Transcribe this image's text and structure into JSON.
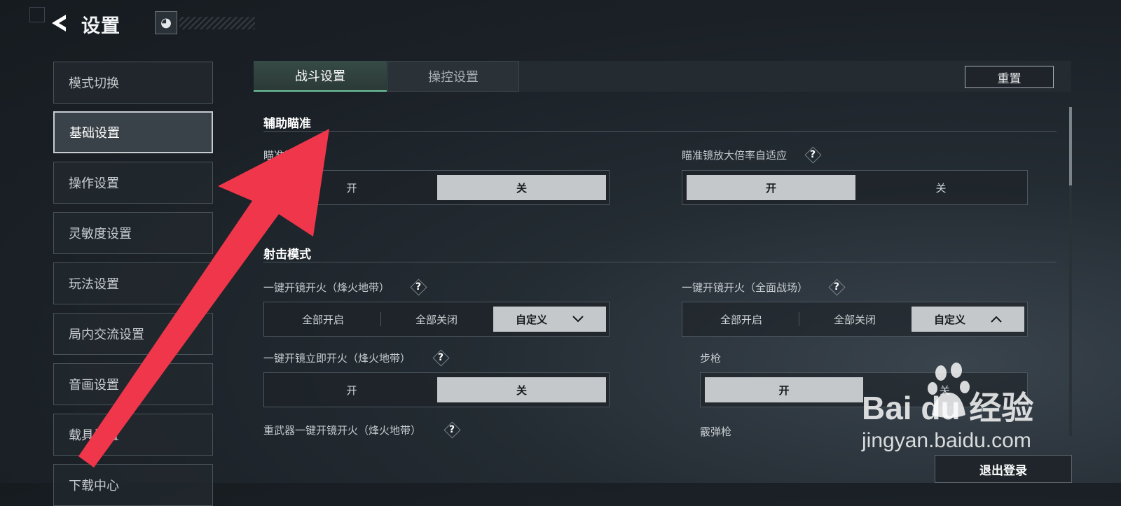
{
  "header": {
    "title": "设置",
    "logo_glyph": "◕"
  },
  "sidebar": {
    "items": [
      {
        "label": "模式切换"
      },
      {
        "label": "基础设置"
      },
      {
        "label": "操作设置"
      },
      {
        "label": "灵敏度设置"
      },
      {
        "label": "玩法设置"
      },
      {
        "label": "局内交流设置"
      },
      {
        "label": "音画设置"
      },
      {
        "label": "载具设置"
      },
      {
        "label": "下载中心"
      }
    ],
    "active_index": 1
  },
  "tabs": [
    {
      "label": "战斗设置"
    },
    {
      "label": "操控设置"
    }
  ],
  "toolbar": {
    "reset_label": "重置",
    "logout_label": "退出登录"
  },
  "sections": {
    "aim_assist": {
      "title": "辅助瞄准",
      "aim_label": "瞄准辅助",
      "aim_options": [
        "开",
        "关"
      ],
      "aim_selected": "关",
      "scope_label": "瞄准镜放大倍率自适应",
      "scope_options": [
        "开",
        "关"
      ],
      "scope_selected": "开"
    },
    "fire_mode": {
      "title": "射击模式",
      "scope_fire_warzone_label": "一键开镜开火（烽火地带）",
      "scope_fire_warzone_options": [
        "全部开启",
        "全部关闭",
        "自定义"
      ],
      "scope_fire_warzone_selected": "自定义",
      "scope_fire_battlefield_label": "一键开镜开火（全面战场）",
      "scope_fire_battlefield_options": [
        "全部开启",
        "全部关闭",
        "自定义"
      ],
      "scope_fire_battlefield_selected": "自定义",
      "instant_fire_label": "一键开镜立即开火（烽火地带）",
      "instant_fire_options": [
        "开",
        "关"
      ],
      "instant_fire_selected": "关",
      "rifle_label": "步枪",
      "rifle_options": [
        "开",
        "关"
      ],
      "rifle_selected": "开",
      "heavy_label": "重武器一键开镜开火（烽火地带）",
      "shotgun_label": "霰弹枪"
    }
  },
  "help_glyph": "?",
  "icons": {
    "back": "back-arrow-icon",
    "help": "help-icon",
    "chevron_down": "chevron-down-icon",
    "chevron_up": "chevron-up-icon"
  },
  "watermark": {
    "brand": "Bai du 经验",
    "url": "jingyan.baidu.com"
  },
  "colors": {
    "accent_green": "#6fc7a0",
    "selected_bg": "#c5c8cb",
    "arrow_red": "#f0364a"
  }
}
